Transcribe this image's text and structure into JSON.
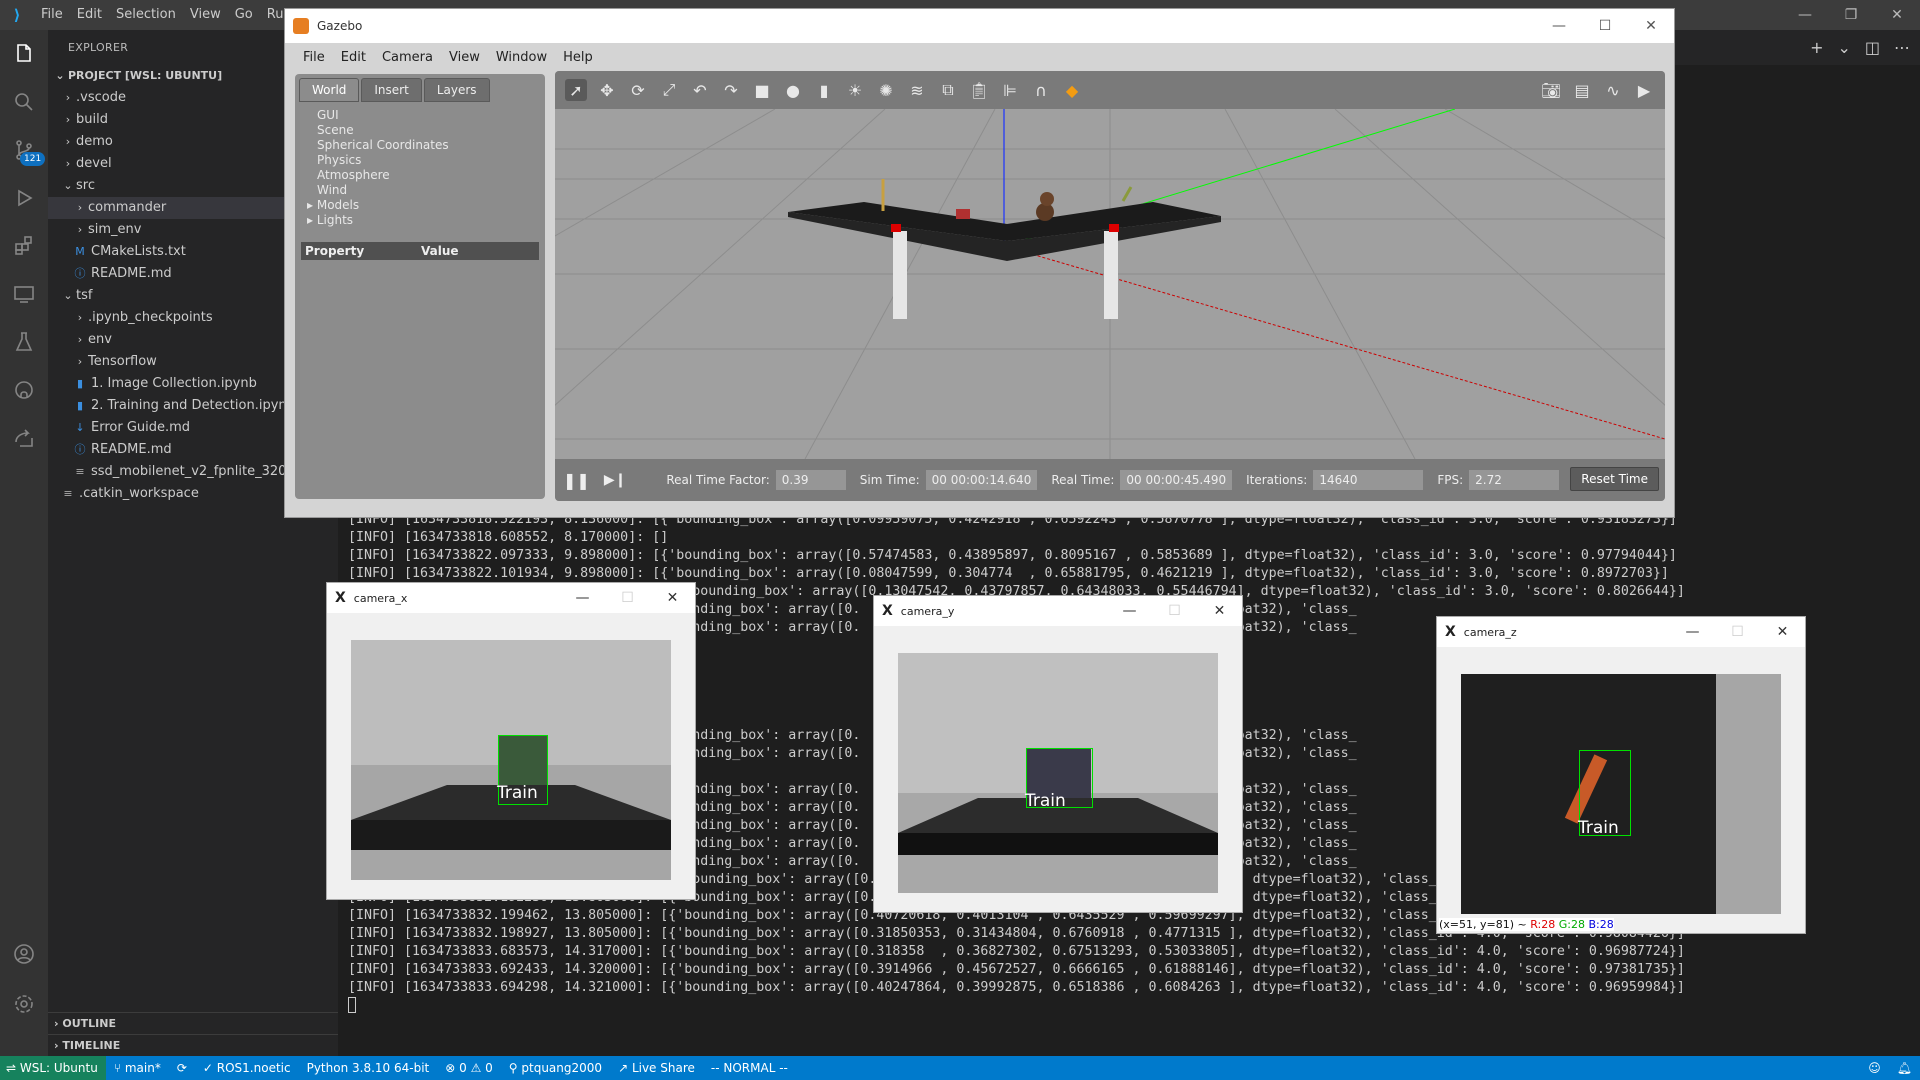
{
  "vscode": {
    "menu": [
      "File",
      "Edit",
      "Selection",
      "View",
      "Go",
      "Run"
    ],
    "explorer_title": "EXPLORER",
    "scm_badge": "121",
    "project_label": "PROJECT [WSL: UBUNTU]",
    "tree": [
      {
        "label": ".vscode",
        "depth": 1,
        "type": "folder",
        "open": false
      },
      {
        "label": "build",
        "depth": 1,
        "type": "folder",
        "open": false
      },
      {
        "label": "demo",
        "depth": 1,
        "type": "folder",
        "open": false
      },
      {
        "label": "devel",
        "depth": 1,
        "type": "folder",
        "open": false
      },
      {
        "label": "src",
        "depth": 1,
        "type": "folder",
        "open": true
      },
      {
        "label": "commander",
        "depth": 2,
        "type": "folder",
        "open": false,
        "selected": true
      },
      {
        "label": "sim_env",
        "depth": 2,
        "type": "folder",
        "open": false
      },
      {
        "label": "CMakeLists.txt",
        "depth": 2,
        "type": "cmake"
      },
      {
        "label": "README.md",
        "depth": 2,
        "type": "info"
      },
      {
        "label": "tsf",
        "depth": 1,
        "type": "folder",
        "open": true
      },
      {
        "label": ".ipynb_checkpoints",
        "depth": 2,
        "type": "folder",
        "open": false
      },
      {
        "label": "env",
        "depth": 2,
        "type": "folder",
        "open": false
      },
      {
        "label": "Tensorflow",
        "depth": 2,
        "type": "folder",
        "open": false
      },
      {
        "label": "1. Image Collection.ipynb",
        "depth": 2,
        "type": "notebook"
      },
      {
        "label": "2. Training and Detection.ipynb",
        "depth": 2,
        "type": "notebook"
      },
      {
        "label": "Error Guide.md",
        "depth": 2,
        "type": "markdown"
      },
      {
        "label": "README.md",
        "depth": 2,
        "type": "info"
      },
      {
        "label": "ssd_mobilenet_v2_fpnlite_320x320",
        "depth": 2,
        "type": "file"
      },
      {
        "label": ".catkin_workspace",
        "depth": 1,
        "type": "file"
      }
    ],
    "outline": "OUTLINE",
    "timeline": "TIMELINE",
    "terminal_lines": [
      "[INFO] [1634733818.522193, 8.136000]: [{'bounding_box': array([0.09959075, 0.4242918 , 0.6592243 , 0.5870778 ], dtype=float32), 'class_id': 3.0, 'score': 0.93183273}]",
      "[INFO] [1634733818.608552, 8.170000]: []",
      "[INFO] [1634733822.097333, 9.898000]: [{'bounding_box': array([0.57474583, 0.43895897, 0.8095167 , 0.5853689 ], dtype=float32), 'class_id': 3.0, 'score': 0.97794044}]",
      "[INFO] [1634733822.101934, 9.898000]: [{'bounding_box': array([0.08047599, 0.304774  , 0.65881795, 0.4621219 ], dtype=float32), 'class_id': 3.0, 'score': 0.8972703}]",
      "[INFO] [1634733822.                  ]: [{'bounding_box': array([0.13047542, 0.43797857, 0.64348033, 0.55446794], dtype=float32), 'class_id': 3.0, 'score': 0.8026644}]",
      "                                        bounding_box': array([0.                                       dtype=float32), 'class_",
      "                                        bounding_box': array([0.                                       dtype=float32), 'class_",
      "",
      "",
      "",
      "",
      "",
      "                                        bounding_box': array([0.                                       dtype=float32), 'class_",
      "                                        bounding_box': array([0.                                       dtype=float32), 'class_",
      "",
      "                                        bounding_box': array([0.                                       dtype=float32), 'class_",
      "                                        bounding_box': array([0.                                       dtype=float32), 'class_",
      "                                        bounding_box': array([0.                                       dtype=float32), 'class_",
      "                                        bounding_box': array([0.                                       dtype=float32), 'class_",
      "                                        bounding_box': array([0.                                       dtype=float32), 'class_",
      "[INFO] [1634733830.614722, 13.140000]: [{'bounding_box': array([0.31404918, 0.23326458, 0.6748629 , 0.40329534], dtype=float32), 'class_",
      "[INFO] [1634733832.192230, 13.803000]: [{'bounding_box': array([0.39470726, 0.4822042 , 0.6597851 , 0.68101084], dtype=float32), 'class_id': 4.0, 'score': 0.8261941}]",
      "[INFO] [1634733832.199462, 13.805000]: [{'bounding_box': array([0.40720618, 0.4013104 , 0.6435529 , 0.59699297], dtype=float32), 'class_id': 4.0, 'score': 0.9513351}]",
      "[INFO] [1634733832.198927, 13.805000]: [{'bounding_box': array([0.31850353, 0.31434804, 0.6760918 , 0.4771315 ], dtype=float32), 'class_id': 4.0, 'score': 0.98084426}]",
      "[INFO] [1634733833.683573, 14.317000]: [{'bounding_box': array([0.318358  , 0.36827302, 0.67513293, 0.53033805], dtype=float32), 'class_id': 4.0, 'score': 0.96987724}]",
      "[INFO] [1634733833.692433, 14.320000]: [{'bounding_box': array([0.3914966 , 0.45672527, 0.6666165 , 0.61888146], dtype=float32), 'class_id': 4.0, 'score': 0.97381735}]",
      "[INFO] [1634733833.694298, 14.321000]: [{'bounding_box': array([0.40247864, 0.39992875, 0.6518386 , 0.6084263 ], dtype=float32), 'class_id': 4.0, 'score': 0.96959984}]"
    ],
    "status": {
      "remote": "WSL: Ubuntu",
      "branch": "main*",
      "ros": "ROS1.noetic",
      "python": "Python 3.8.10 64-bit",
      "problems": "0 ⚠ 0",
      "user": "ptquang2000",
      "liveshare": "Live Share",
      "mode": "-- NORMAL --"
    }
  },
  "gazebo": {
    "title": "Gazebo",
    "menu": [
      "File",
      "Edit",
      "Camera",
      "View",
      "Window",
      "Help"
    ],
    "tabs": [
      "World",
      "Insert",
      "Layers"
    ],
    "tree": [
      "GUI",
      "Scene",
      "Spherical Coordinates",
      "Physics",
      "Atmosphere",
      "Wind",
      "Models",
      "Lights"
    ],
    "prop_header": [
      "Property",
      "Value"
    ],
    "rtf_label": "Real Time Factor:",
    "rtf": "0.39",
    "sim_label": "Sim Time:",
    "sim": "00 00:00:14.640",
    "real_label": "Real Time:",
    "real": "00 00:00:45.490",
    "iter_label": "Iterations:",
    "iter": "14640",
    "fps_label": "FPS:",
    "fps": "2.72",
    "reset": "Reset Time"
  },
  "cams": {
    "x": {
      "title": "camera_x",
      "label": "Train"
    },
    "y": {
      "title": "camera_y",
      "label": "Train"
    },
    "z": {
      "title": "camera_z",
      "label": "Train",
      "status_pos": "(x=51, y=81) ~ ",
      "r": "R:28",
      "g": "G:28",
      "b": "B:28"
    }
  }
}
